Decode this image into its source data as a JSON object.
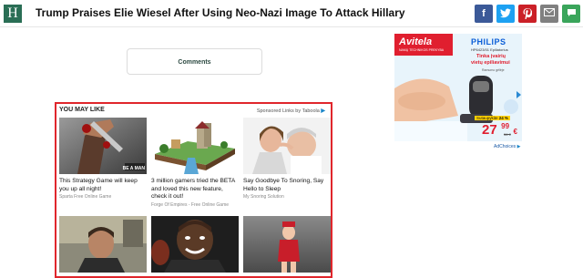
{
  "header": {
    "logo_letter": "H",
    "headline": "Trump Praises Elie Wiesel After Using Neo-Nazi Image To Attack Hillary",
    "share_buttons": [
      {
        "name": "facebook",
        "glyph": "f",
        "color": "#3b5998"
      },
      {
        "name": "twitter",
        "glyph": "t",
        "color": "#1da1f2"
      },
      {
        "name": "pinterest",
        "glyph": "p",
        "color": "#cb2027"
      },
      {
        "name": "email",
        "glyph": "✉",
        "color": "#808080"
      },
      {
        "name": "comment",
        "glyph": "💬",
        "color": "#3aa55b"
      }
    ]
  },
  "comments": {
    "label": "Comments"
  },
  "taboola": {
    "heading": "YOU MAY LIKE",
    "sponsored": "Sponsored Links by",
    "brand": "Taboola",
    "cards": [
      {
        "title": "This Strategy Game will keep you up all night!",
        "source": "Sparta Free Online Game",
        "image_text": "BE A MAN"
      },
      {
        "title": "3 million gamers tried the BETA and loved this new feature, check it out!",
        "source": "Forge Of Empires - Free Online Game"
      },
      {
        "title": "Say Goodbye To Snoring, Say Hello to Sleep",
        "source": "My Snoring Solution"
      },
      {
        "title": "",
        "source": ""
      },
      {
        "title": "",
        "source": ""
      },
      {
        "title": "",
        "source": ""
      }
    ]
  },
  "ad": {
    "store": "Avitela",
    "store_tagline": "NAMŲ TECHNIKOS PREKYBA",
    "brand": "PHILIPS",
    "model": "HP6423/01 Epiliatorius",
    "promo_line1": "Tinka įvairių",
    "promo_line2": "vietų epiliavimui",
    "promo_line3": "Ramumo gėlėje",
    "discount_label": "Sutaupykite",
    "discount": "24 %",
    "price_main": "27",
    "price_cents": "99",
    "currency": "€",
    "old_price": "36 €",
    "adchoices": "AdChoices"
  }
}
